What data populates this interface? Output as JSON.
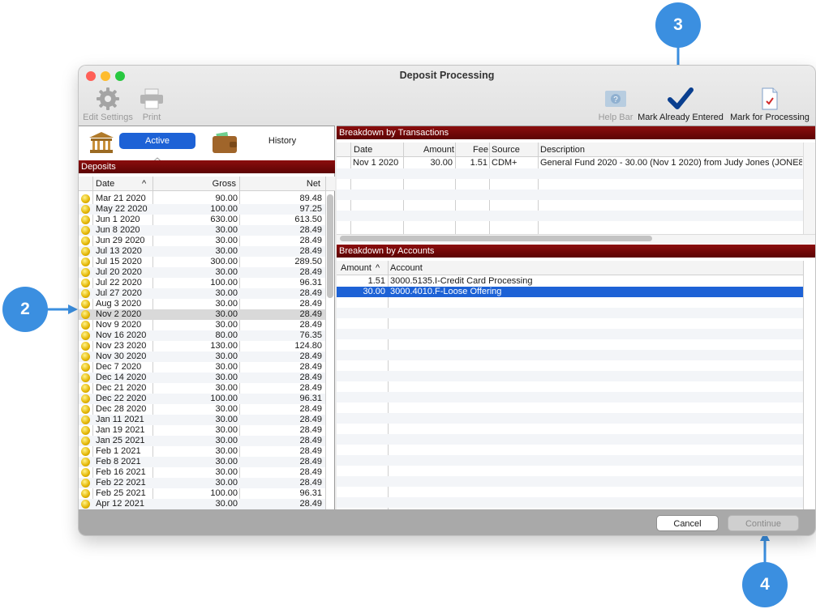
{
  "window": {
    "title": "Deposit Processing"
  },
  "callouts": {
    "two": "2",
    "three": "3",
    "four": "4"
  },
  "toolbar": {
    "edit_settings": "Edit Settings",
    "print": "Print",
    "help_bar": "Help Bar",
    "mark_already_entered": "Mark Already Entered",
    "mark_for_processing": "Mark for Processing"
  },
  "tabs": {
    "active": "Active",
    "history": "History"
  },
  "deposits": {
    "title": "Deposits",
    "columns": {
      "date": "Date",
      "sort_indicator": "^",
      "gross": "Gross",
      "net": "Net"
    },
    "selected_index": 11,
    "rows": [
      {
        "date": "Mar 21 2020",
        "gross": "90.00",
        "net": "89.48"
      },
      {
        "date": "May 22 2020",
        "gross": "100.00",
        "net": "97.25"
      },
      {
        "date": "Jun 1 2020",
        "gross": "630.00",
        "net": "613.50"
      },
      {
        "date": "Jun 8 2020",
        "gross": "30.00",
        "net": "28.49"
      },
      {
        "date": "Jun 29 2020",
        "gross": "30.00",
        "net": "28.49"
      },
      {
        "date": "Jul 13 2020",
        "gross": "30.00",
        "net": "28.49"
      },
      {
        "date": "Jul 15 2020",
        "gross": "300.00",
        "net": "289.50"
      },
      {
        "date": "Jul 20 2020",
        "gross": "30.00",
        "net": "28.49"
      },
      {
        "date": "Jul 22 2020",
        "gross": "100.00",
        "net": "96.31"
      },
      {
        "date": "Jul 27 2020",
        "gross": "30.00",
        "net": "28.49"
      },
      {
        "date": "Aug 3 2020",
        "gross": "30.00",
        "net": "28.49"
      },
      {
        "date": "Nov 2 2020",
        "gross": "30.00",
        "net": "28.49"
      },
      {
        "date": "Nov 9 2020",
        "gross": "30.00",
        "net": "28.49"
      },
      {
        "date": "Nov 16 2020",
        "gross": "80.00",
        "net": "76.35"
      },
      {
        "date": "Nov 23 2020",
        "gross": "130.00",
        "net": "124.80"
      },
      {
        "date": "Nov 30 2020",
        "gross": "30.00",
        "net": "28.49"
      },
      {
        "date": "Dec 7 2020",
        "gross": "30.00",
        "net": "28.49"
      },
      {
        "date": "Dec 14 2020",
        "gross": "30.00",
        "net": "28.49"
      },
      {
        "date": "Dec 21 2020",
        "gross": "30.00",
        "net": "28.49"
      },
      {
        "date": "Dec 22 2020",
        "gross": "100.00",
        "net": "96.31"
      },
      {
        "date": "Dec 28 2020",
        "gross": "30.00",
        "net": "28.49"
      },
      {
        "date": "Jan 11 2021",
        "gross": "30.00",
        "net": "28.49"
      },
      {
        "date": "Jan 19 2021",
        "gross": "30.00",
        "net": "28.49"
      },
      {
        "date": "Jan 25 2021",
        "gross": "30.00",
        "net": "28.49"
      },
      {
        "date": "Feb 1 2021",
        "gross": "30.00",
        "net": "28.49"
      },
      {
        "date": "Feb 8 2021",
        "gross": "30.00",
        "net": "28.49"
      },
      {
        "date": "Feb 16 2021",
        "gross": "30.00",
        "net": "28.49"
      },
      {
        "date": "Feb 22 2021",
        "gross": "30.00",
        "net": "28.49"
      },
      {
        "date": "Feb 25 2021",
        "gross": "100.00",
        "net": "96.31"
      },
      {
        "date": "Apr 12 2021",
        "gross": "30.00",
        "net": "28.49"
      }
    ]
  },
  "transactions": {
    "title": "Breakdown by Transactions",
    "columns": {
      "date": "Date",
      "amount": "Amount",
      "fee": "Fee",
      "source": "Source",
      "description": "Description"
    },
    "rows": [
      {
        "date": "Nov 1 2020",
        "amount": "30.00",
        "fee": "1.51",
        "source": "CDM+",
        "description": "General Fund 2020 - 30.00 (Nov 1 2020) from Judy Jones (JONE8"
      }
    ]
  },
  "accounts": {
    "title": "Breakdown by Accounts",
    "columns": {
      "amount": "Amount",
      "sort_indicator": "^",
      "account": "Account"
    },
    "selected_index": 1,
    "rows": [
      {
        "amount": "1.51",
        "account": "3000.5135.I-Credit Card Processing"
      },
      {
        "amount": "30.00",
        "account": "3000.4010.F-Loose Offering"
      }
    ]
  },
  "footer": {
    "cancel": "Cancel",
    "continue": "Continue"
  },
  "colors": {
    "accent": "#1d62d6",
    "section_bar": "#7a0a0a",
    "callout": "#3b8fe0"
  }
}
